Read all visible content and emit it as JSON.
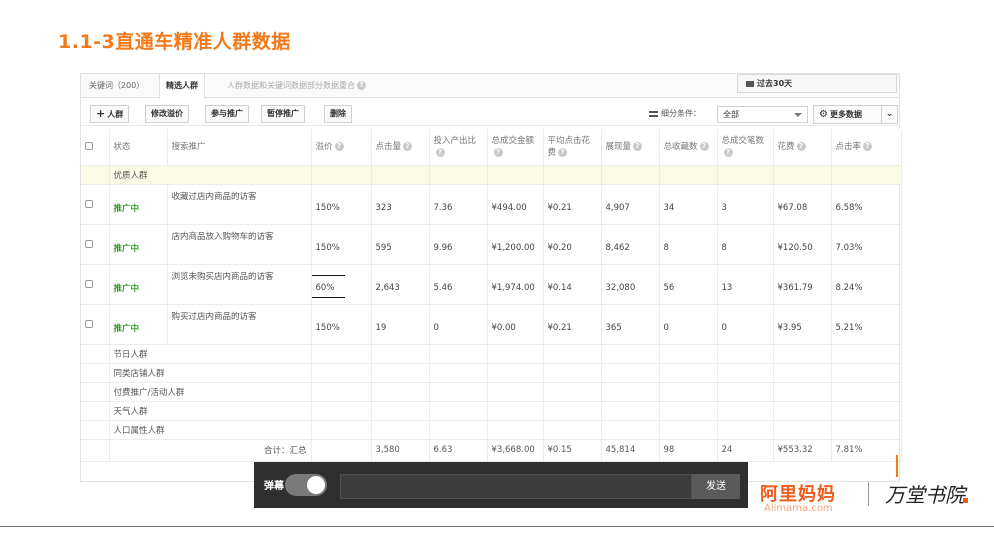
{
  "slide_title": "1.1-3直通车精准人群数据",
  "tabs": [
    {
      "label": "关键词（200）"
    },
    {
      "label": "精选人群"
    }
  ],
  "tab_note": "人群数据和关键词数据部分数据重合",
  "date_range": "过去30天",
  "toolbar": {
    "add_label": "人群",
    "modify_bid": "修改溢价",
    "join_promo": "参与推广",
    "pause_promo": "暂停推广",
    "delete": "删除",
    "filter_label": "细分条件：",
    "filter_value": "全部",
    "more_data": "更多数据"
  },
  "columns": [
    "状态",
    "搜索推广",
    "溢价",
    "点击量",
    "投入产出比",
    "总成交金额",
    "平均点击花费",
    "展现量",
    "总收藏数",
    "总成交笔数",
    "花费",
    "点击率"
  ],
  "groups": {
    "premium": "优质人群",
    "holiday": "节日人群",
    "similar_shop": "同类店铺人群",
    "paid_event": "付费推广/活动人群",
    "weather": "天气人群",
    "demographic": "人口属性人群"
  },
  "rows": [
    {
      "status": "推广中",
      "name": "收藏过店内商品的访客",
      "bid": "150%",
      "clicks": "323",
      "roi": "7.36",
      "gmv": "¥494.00",
      "cpc": "¥0.21",
      "impressions": "4,907",
      "favorites": "34",
      "orders": "3",
      "cost": "¥67.08",
      "ctr": "6.58%"
    },
    {
      "status": "推广中",
      "name": "店内商品放入购物车的访客",
      "bid": "150%",
      "clicks": "595",
      "roi": "9.96",
      "gmv": "¥1,200.00",
      "cpc": "¥0.20",
      "impressions": "8,462",
      "favorites": "8",
      "orders": "8",
      "cost": "¥120.50",
      "ctr": "7.03%"
    },
    {
      "status": "推广中",
      "name": "浏览未购买店内商品的访客",
      "bid": "60%",
      "clicks": "2,643",
      "roi": "5.46",
      "gmv": "¥1,974.00",
      "cpc": "¥0.14",
      "impressions": "32,080",
      "favorites": "56",
      "orders": "13",
      "cost": "¥361.79",
      "ctr": "8.24%"
    },
    {
      "status": "推广中",
      "name": "购买过店内商品的访客",
      "bid": "150%",
      "clicks": "19",
      "roi": "0",
      "gmv": "¥0.00",
      "cpc": "¥0.21",
      "impressions": "365",
      "favorites": "0",
      "orders": "0",
      "cost": "¥3.95",
      "ctr": "5.21%"
    }
  ],
  "summary": {
    "label": "合计：汇总",
    "clicks": "3,580",
    "roi": "6.63",
    "gmv": "¥3,668.00",
    "cpc": "¥0.15",
    "impressions": "45,814",
    "favorites": "98",
    "orders": "24",
    "cost": "¥553.32",
    "ctr": "7.81%"
  },
  "danmu": {
    "label": "弹幕",
    "send": "发送"
  },
  "brand": {
    "alimama": "阿里妈妈",
    "alimama_sub": "Alimama.com",
    "college": "万堂书院"
  },
  "colors": {
    "accent": "#f27a1a",
    "status_green": "#3a9b2e",
    "highlight_row": "#fcfbe6"
  }
}
